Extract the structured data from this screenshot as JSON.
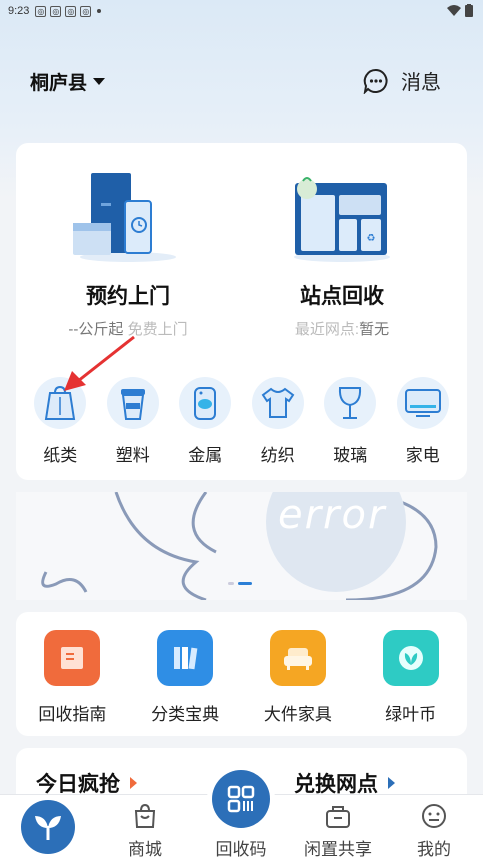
{
  "status_bar": {
    "time": "9:23"
  },
  "header": {
    "location": "桐庐县",
    "message_label": "消息"
  },
  "services": [
    {
      "title": "预约上门",
      "sub_prefix": "--公斤起",
      "sub_suffix": " 免费上门"
    },
    {
      "title": "站点回收",
      "sub_prefix": "最近网点:",
      "sub_suffix": "暂无"
    }
  ],
  "categories": [
    {
      "label": "纸类",
      "icon": "paper-bag-icon"
    },
    {
      "label": "塑料",
      "icon": "plastic-cup-icon"
    },
    {
      "label": "金属",
      "icon": "metal-can-icon"
    },
    {
      "label": "纺织",
      "icon": "tshirt-icon"
    },
    {
      "label": "玻璃",
      "icon": "glass-icon"
    },
    {
      "label": "家电",
      "icon": "appliance-icon"
    }
  ],
  "banner": {
    "text": "error"
  },
  "tools": [
    {
      "label": "回收指南",
      "icon": "guide-book-icon",
      "color": "#f06b3c"
    },
    {
      "label": "分类宝典",
      "icon": "books-icon",
      "color": "#2f8ee5"
    },
    {
      "label": "大件家具",
      "icon": "sofa-icon",
      "color": "#f5a623"
    },
    {
      "label": "绿叶币",
      "icon": "leaf-coin-icon",
      "color": "#2ecbc4"
    }
  ],
  "sections": {
    "deals": "今日疯抢",
    "exchange": "兑换网点"
  },
  "tabbar": {
    "mall": "商城",
    "qr": "回收码",
    "share": "闲置共享",
    "mine": "我的"
  },
  "colors": {
    "primary": "#2c6fb8",
    "accent_orange": "#f06b3c"
  }
}
